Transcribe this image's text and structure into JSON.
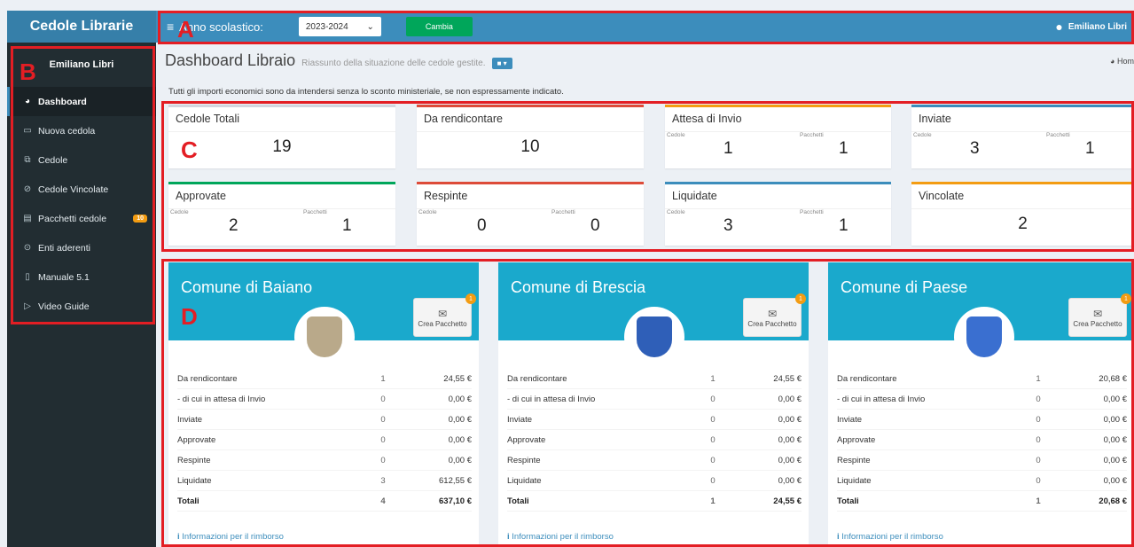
{
  "app": {
    "brand": "Cedole Librarie"
  },
  "topbar": {
    "menu_icon": "hamburger-icon",
    "year_label": "Anno scolastico:",
    "year_value": "2023-2024",
    "cambia_label": "Cambia",
    "user_name": "Emiliano Libri"
  },
  "sidebar": {
    "user_name": "Emiliano Libri",
    "items": [
      {
        "label": "Dashboard",
        "icon": "dashboard-icon",
        "active": true
      },
      {
        "label": "Nuova cedola",
        "icon": "monitor-icon"
      },
      {
        "label": "Cedole",
        "icon": "copy-icon"
      },
      {
        "label": "Cedole Vincolate",
        "icon": "ban-icon"
      },
      {
        "label": "Pacchetti cedole",
        "icon": "package-icon",
        "badge": "10"
      },
      {
        "label": "Enti aderenti",
        "icon": "circle-dot-icon"
      },
      {
        "label": "Manuale 5.1",
        "icon": "book-icon"
      },
      {
        "label": "Video Guide",
        "icon": "play-icon"
      }
    ]
  },
  "header": {
    "title": "Dashboard Libraio",
    "subtitle": "Riassunto della situazione delle cedole gestite.",
    "home_label": "Hom",
    "notice": "Tutti gli importi economici sono da intendersi senza lo sconto ministeriale, se non espressamente indicato."
  },
  "stats": {
    "cedole_label": "Cedole",
    "pacchetti_label": "Pacchetti",
    "totali": {
      "title": "Cedole Totali",
      "value": "19"
    },
    "rendicontare": {
      "title": "Da rendicontare",
      "value": "10"
    },
    "attesa": {
      "title": "Attesa di Invio",
      "cedole": "1",
      "pacchetti": "1"
    },
    "inviate": {
      "title": "Inviate",
      "cedole": "3",
      "pacchetti": "1"
    },
    "approvate": {
      "title": "Approvate",
      "cedole": "2",
      "pacchetti": "1"
    },
    "respinte": {
      "title": "Respinte",
      "cedole": "0",
      "pacchetti": "0"
    },
    "liquidate": {
      "title": "Liquidate",
      "cedole": "3",
      "pacchetti": "1"
    },
    "vincolate": {
      "title": "Vincolate",
      "value": "2"
    }
  },
  "colors": {
    "green": "#00a65a",
    "red": "#dd4b39",
    "blue": "#3c8dbc",
    "orange": "#f39c12",
    "teal": "#1aa9cc"
  },
  "entes": [
    {
      "name": "Comune di Baiano",
      "crea_label": "Crea Pacchetto",
      "badge": "1",
      "rows": [
        {
          "label": "Da rendicontare",
          "count": "1",
          "amount": "24,55 €"
        },
        {
          "label": "- di cui in attesa di Invio",
          "count": "0",
          "amount": "0,00 €"
        },
        {
          "label": "Inviate",
          "count": "0",
          "amount": "0,00 €"
        },
        {
          "label": "Approvate",
          "count": "0",
          "amount": "0,00 €"
        },
        {
          "label": "Respinte",
          "count": "0",
          "amount": "0,00 €"
        },
        {
          "label": "Liquidate",
          "count": "3",
          "amount": "612,55 €"
        },
        {
          "label": "Totali",
          "count": "4",
          "amount": "637,10 €"
        }
      ],
      "info_label": "Informazioni per il rimborso"
    },
    {
      "name": "Comune di Brescia",
      "crea_label": "Crea Pacchetto",
      "badge": "1",
      "rows": [
        {
          "label": "Da rendicontare",
          "count": "1",
          "amount": "24,55 €"
        },
        {
          "label": "- di cui in attesa di Invio",
          "count": "0",
          "amount": "0,00 €"
        },
        {
          "label": "Inviate",
          "count": "0",
          "amount": "0,00 €"
        },
        {
          "label": "Approvate",
          "count": "0",
          "amount": "0,00 €"
        },
        {
          "label": "Respinte",
          "count": "0",
          "amount": "0,00 €"
        },
        {
          "label": "Liquidate",
          "count": "0",
          "amount": "0,00 €"
        },
        {
          "label": "Totali",
          "count": "1",
          "amount": "24,55 €"
        }
      ],
      "info_label": "Informazioni per il rimborso"
    },
    {
      "name": "Comune di Paese",
      "crea_label": "Crea Pacchetto",
      "badge": "1",
      "rows": [
        {
          "label": "Da rendicontare",
          "count": "1",
          "amount": "20,68 €"
        },
        {
          "label": "- di cui in attesa di Invio",
          "count": "0",
          "amount": "0,00 €"
        },
        {
          "label": "Inviate",
          "count": "0",
          "amount": "0,00 €"
        },
        {
          "label": "Approvate",
          "count": "0",
          "amount": "0,00 €"
        },
        {
          "label": "Respinte",
          "count": "0",
          "amount": "0,00 €"
        },
        {
          "label": "Liquidate",
          "count": "0",
          "amount": "0,00 €"
        },
        {
          "label": "Totali",
          "count": "1",
          "amount": "20,68 €"
        }
      ],
      "info_label": "Informazioni per il rimborso"
    }
  ],
  "annotations": {
    "a": "A",
    "b": "B",
    "c": "C",
    "d": "D"
  }
}
